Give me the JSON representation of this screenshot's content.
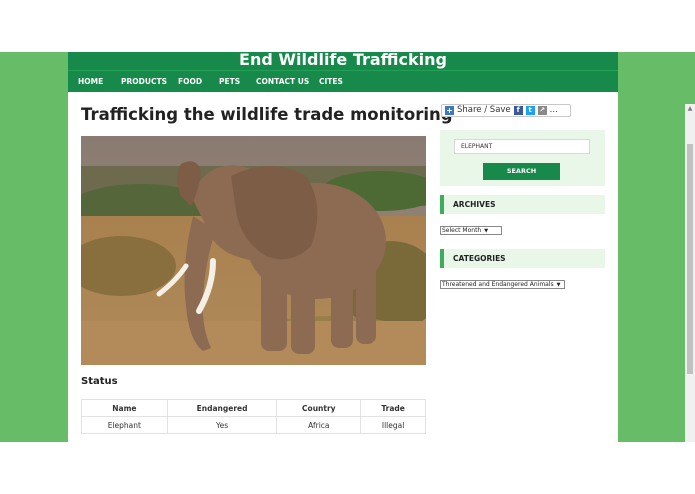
{
  "site": {
    "title": "End Wildlife Trafficking"
  },
  "nav": {
    "items": [
      "HOME",
      "PRODUCTS",
      "FOOD",
      "PETS",
      "CONTACT US",
      "CITES"
    ]
  },
  "post": {
    "title": "Trafficking the wildlife trade monitoring"
  },
  "status": {
    "heading": "Status",
    "columns": [
      "Name",
      "Endangered",
      "Country",
      "Trade"
    ],
    "rows": [
      [
        "Elephant",
        "Yes",
        "Africa",
        "Illegal"
      ]
    ]
  },
  "share": {
    "label": "Share / Save",
    "more": "..."
  },
  "search": {
    "value": "ELEPHANT",
    "button": "SEARCH"
  },
  "archives": {
    "title": "ARCHIVES",
    "select": "Select Month"
  },
  "categories": {
    "title": "CATEGORIES",
    "select": "Threatened and Endangered Animals"
  },
  "colors": {
    "brand": "#17894a",
    "background": "#67bd67",
    "widget_bg": "#e9f7e9",
    "accent": "#3cae5a"
  },
  "icons": {
    "share": [
      "plus-icon",
      "facebook-icon",
      "twitter-icon",
      "share-icon"
    ]
  }
}
